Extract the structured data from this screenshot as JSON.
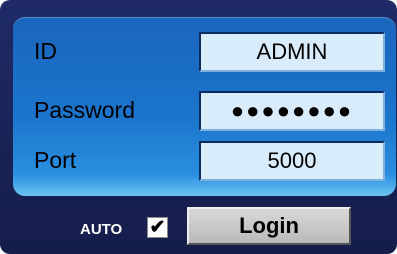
{
  "form": {
    "id_label": "ID",
    "id_value": "ADMIN",
    "password_label": "Password",
    "password_value": "●●●●●●●●",
    "port_label": "Port",
    "port_value": "5000"
  },
  "footer": {
    "auto_label": "AUTO",
    "auto_checked": true,
    "check_glyph": "✔",
    "login_label": "Login"
  },
  "colors": {
    "panel_dark": "#1f2b66",
    "panel_blue": "#1b74cc",
    "field_bg": "#d9ecfb",
    "button_gray": "#c8c8c8"
  }
}
